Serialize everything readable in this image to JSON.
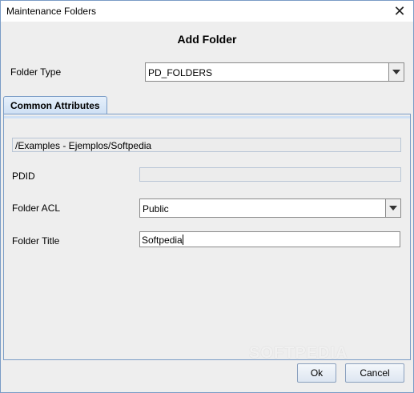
{
  "window": {
    "title": "Maintenance Folders",
    "close_glyph": "✕"
  },
  "dialog": {
    "heading": "Add Folder"
  },
  "folder_type": {
    "label": "Folder Type",
    "selected": "PD_FOLDERS"
  },
  "tabs": [
    {
      "label": "Common Attributes",
      "active": true
    }
  ],
  "attributes": {
    "path": "/Examples - Ejemplos/Softpedia",
    "pdid": {
      "label": "PDID",
      "value": ""
    },
    "acl": {
      "label": "Folder ACL",
      "selected": "Public"
    },
    "title": {
      "label": "Folder Title",
      "value": "Softpedia"
    }
  },
  "buttons": {
    "ok": "Ok",
    "cancel": "Cancel"
  },
  "watermark": "SOFTPEDIA",
  "icons": {
    "dropdown": "chevron-down-icon",
    "close": "close-icon"
  },
  "colors": {
    "accent_border": "#7a9cc6",
    "tab_fill": "#cfe0f4",
    "background": "#eeeeee"
  }
}
